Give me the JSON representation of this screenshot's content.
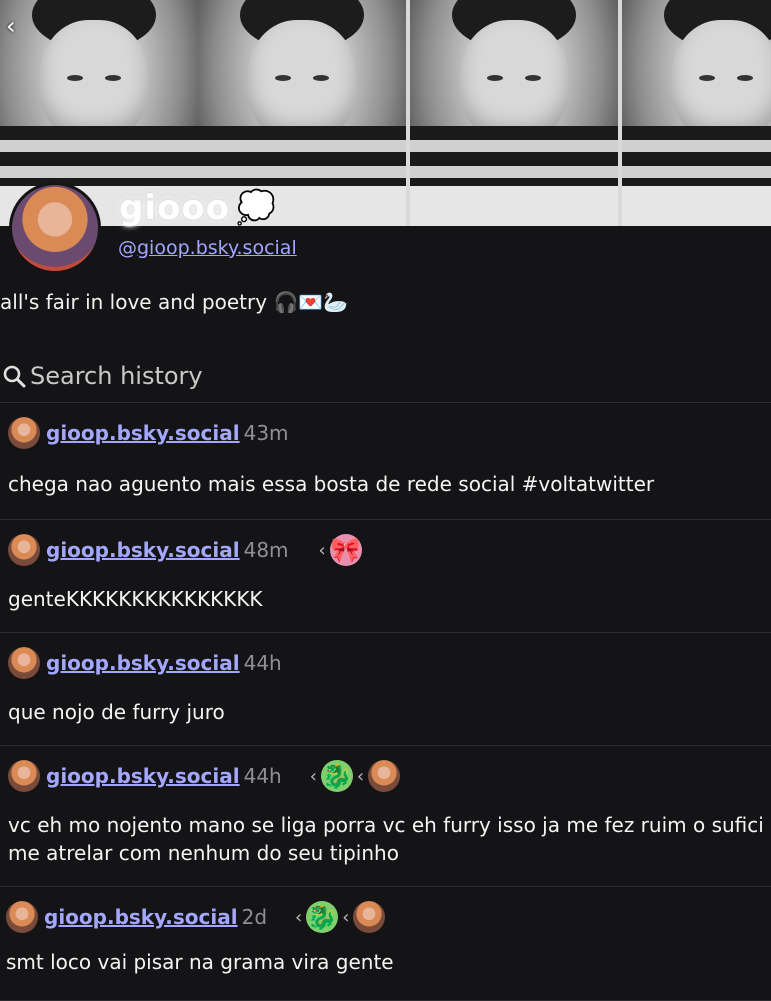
{
  "profile": {
    "display_name": "giooo",
    "handle": "gioop.bsky.social",
    "handle_prefix": "@",
    "bio": "all's fair in love and poetry 🎧💌🦢",
    "thought_emoji": "💭"
  },
  "search": {
    "placeholder": "Search history"
  },
  "posts": [
    {
      "user": "gioop.bsky.social",
      "time": "43m",
      "text": "chega nao aguento mais essa bosta de rede social #voltatwitter",
      "reply_avatars": []
    },
    {
      "user": "gioop.bsky.social",
      "time": "48m",
      "text": "genteKKKKKKKKKKKKKKK",
      "reply_avatars": [
        "kirby-avatar"
      ]
    },
    {
      "user": "gioop.bsky.social",
      "time": "44h",
      "text": "que nojo de furry juro",
      "reply_avatars": []
    },
    {
      "user": "gioop.bsky.social",
      "time": "44h",
      "text": "vc eh mo nojento mano se liga porra vc eh furry isso ja me fez ruim o sufici",
      "text2": "me atrelar com nenhum do seu tipinho",
      "reply_avatars": [
        "dragon-avatar",
        "gioop-avatar"
      ]
    },
    {
      "user": "gioop.bsky.social",
      "time": "2d",
      "text": "smt loco vai pisar na grama vira gente",
      "reply_avatars": [
        "dragon-avatar",
        "gioop-avatar"
      ]
    }
  ],
  "icons": {
    "back": "chevron-left-icon",
    "search": "search-icon",
    "reply_chevron": "chevron-left-small-icon"
  },
  "colors": {
    "background": "#141416",
    "link": "#a3a7ff",
    "muted": "#8f8f96"
  }
}
